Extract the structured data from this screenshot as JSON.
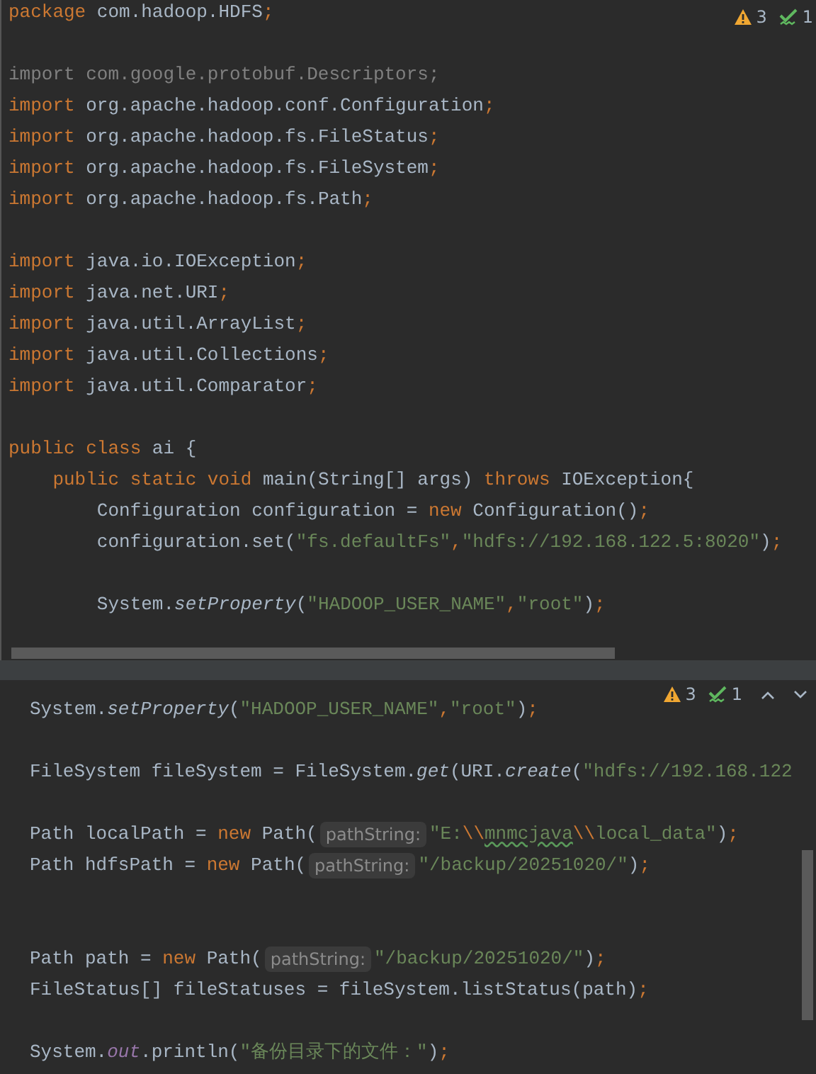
{
  "top_pane": {
    "inspections": {
      "warnings": "3",
      "weak_warnings": "1"
    },
    "lines": [
      {
        "kind": "code",
        "tokens": [
          {
            "kind": "kw",
            "text": "package"
          },
          {
            "kind": "plain",
            "text": " com.hadoop.HDFS"
          },
          {
            "kind": "punct",
            "text": ";"
          }
        ]
      },
      {
        "kind": "blank"
      },
      {
        "kind": "code",
        "tokens": [
          {
            "kind": "unused",
            "text": "import com.google.protobuf.Descriptors;"
          }
        ]
      },
      {
        "kind": "code",
        "tokens": [
          {
            "kind": "kw",
            "text": "import"
          },
          {
            "kind": "plain",
            "text": " org.apache.hadoop.conf.Configuration"
          },
          {
            "kind": "punct",
            "text": ";"
          }
        ]
      },
      {
        "kind": "code",
        "tokens": [
          {
            "kind": "kw",
            "text": "import"
          },
          {
            "kind": "plain",
            "text": " org.apache.hadoop.fs.FileStatus"
          },
          {
            "kind": "punct",
            "text": ";"
          }
        ]
      },
      {
        "kind": "code",
        "tokens": [
          {
            "kind": "kw",
            "text": "import"
          },
          {
            "kind": "plain",
            "text": " org.apache.hadoop.fs.FileSystem"
          },
          {
            "kind": "punct",
            "text": ";"
          }
        ]
      },
      {
        "kind": "code",
        "tokens": [
          {
            "kind": "kw",
            "text": "import"
          },
          {
            "kind": "plain",
            "text": " org.apache.hadoop.fs.Path"
          },
          {
            "kind": "punct",
            "text": ";"
          }
        ]
      },
      {
        "kind": "blank"
      },
      {
        "kind": "code",
        "tokens": [
          {
            "kind": "kw",
            "text": "import"
          },
          {
            "kind": "plain",
            "text": " java.io.IOException"
          },
          {
            "kind": "punct",
            "text": ";"
          }
        ]
      },
      {
        "kind": "code",
        "tokens": [
          {
            "kind": "kw",
            "text": "import"
          },
          {
            "kind": "plain",
            "text": " java.net.URI"
          },
          {
            "kind": "punct",
            "text": ";"
          }
        ]
      },
      {
        "kind": "code",
        "tokens": [
          {
            "kind": "kw",
            "text": "import"
          },
          {
            "kind": "plain",
            "text": " java.util.ArrayList"
          },
          {
            "kind": "punct",
            "text": ";"
          }
        ]
      },
      {
        "kind": "code",
        "tokens": [
          {
            "kind": "kw",
            "text": "import"
          },
          {
            "kind": "plain",
            "text": " java.util.Collections"
          },
          {
            "kind": "punct",
            "text": ";"
          }
        ]
      },
      {
        "kind": "code",
        "tokens": [
          {
            "kind": "kw",
            "text": "import"
          },
          {
            "kind": "plain",
            "text": " java.util.Comparator"
          },
          {
            "kind": "punct",
            "text": ";"
          }
        ]
      },
      {
        "kind": "blank"
      },
      {
        "kind": "code",
        "tokens": [
          {
            "kind": "kw",
            "text": "public class"
          },
          {
            "kind": "plain",
            "text": " ai {"
          }
        ]
      },
      {
        "kind": "code",
        "tokens": [
          {
            "kind": "kw",
            "text": "    public static void"
          },
          {
            "kind": "plain",
            "text": " main(String[] args) "
          },
          {
            "kind": "kw",
            "text": "throws"
          },
          {
            "kind": "plain",
            "text": " IOException{"
          }
        ]
      },
      {
        "kind": "code",
        "tokens": [
          {
            "kind": "plain",
            "text": "        Configuration configuration = "
          },
          {
            "kind": "kw",
            "text": "new"
          },
          {
            "kind": "plain",
            "text": " Configuration()"
          },
          {
            "kind": "punct",
            "text": ";"
          }
        ]
      },
      {
        "kind": "code",
        "tokens": [
          {
            "kind": "plain",
            "text": "        configuration.set("
          },
          {
            "kind": "str",
            "text": "\"fs.defaultFs\""
          },
          {
            "kind": "punct",
            "text": ","
          },
          {
            "kind": "str",
            "text": "\"hdfs://192.168.122.5:8020\""
          },
          {
            "kind": "plain",
            "text": ")"
          },
          {
            "kind": "punct",
            "text": ";"
          }
        ]
      },
      {
        "kind": "blank"
      },
      {
        "kind": "code",
        "tokens": [
          {
            "kind": "plain",
            "text": "        System."
          },
          {
            "kind": "method",
            "text": "setProperty"
          },
          {
            "kind": "plain",
            "text": "("
          },
          {
            "kind": "str",
            "text": "\"HADOOP_USER_NAME\""
          },
          {
            "kind": "punct",
            "text": ","
          },
          {
            "kind": "str",
            "text": "\"root\""
          },
          {
            "kind": "plain",
            "text": ")"
          },
          {
            "kind": "punct",
            "text": ";"
          }
        ]
      }
    ]
  },
  "bottom_pane": {
    "inspections": {
      "warnings": "3",
      "weak_warnings": "1"
    },
    "lines": [
      {
        "kind": "code",
        "tokens": [
          {
            "kind": "plain",
            "text": "System."
          },
          {
            "kind": "method",
            "text": "setProperty"
          },
          {
            "kind": "plain",
            "text": "("
          },
          {
            "kind": "str",
            "text": "\"HADOOP_USER_NAME\""
          },
          {
            "kind": "punct",
            "text": ","
          },
          {
            "kind": "str",
            "text": "\"root\""
          },
          {
            "kind": "plain",
            "text": ")"
          },
          {
            "kind": "punct",
            "text": ";"
          }
        ]
      },
      {
        "kind": "blank"
      },
      {
        "kind": "code",
        "tokens": [
          {
            "kind": "plain",
            "text": "FileSystem fileSystem = FileSystem."
          },
          {
            "kind": "method",
            "text": "get"
          },
          {
            "kind": "plain",
            "text": "(URI."
          },
          {
            "kind": "method",
            "text": "create"
          },
          {
            "kind": "plain",
            "text": "("
          },
          {
            "kind": "str",
            "text": "\"hdfs://192.168.122"
          }
        ]
      },
      {
        "kind": "blank"
      },
      {
        "kind": "code",
        "tokens": [
          {
            "kind": "plain",
            "text": "Path localPath = "
          },
          {
            "kind": "kw",
            "text": "new"
          },
          {
            "kind": "plain",
            "text": " Path("
          },
          {
            "kind": "hint",
            "text": "pathString:"
          },
          {
            "kind": "str",
            "text": "\"E:"
          },
          {
            "kind": "kw",
            "text": "\\\\"
          },
          {
            "kind": "typo",
            "text": "mnmcjava"
          },
          {
            "kind": "kw",
            "text": "\\\\"
          },
          {
            "kind": "str",
            "text": "local_data\""
          },
          {
            "kind": "plain",
            "text": ")"
          },
          {
            "kind": "punct",
            "text": ";"
          }
        ]
      },
      {
        "kind": "code",
        "tokens": [
          {
            "kind": "plain",
            "text": "Path hdfsPath = "
          },
          {
            "kind": "kw",
            "text": "new"
          },
          {
            "kind": "plain",
            "text": " Path("
          },
          {
            "kind": "hint",
            "text": "pathString:"
          },
          {
            "kind": "str",
            "text": "\"/backup/20251020/\""
          },
          {
            "kind": "plain",
            "text": ")"
          },
          {
            "kind": "punct",
            "text": ";"
          }
        ]
      },
      {
        "kind": "blank"
      },
      {
        "kind": "blank"
      },
      {
        "kind": "code",
        "tokens": [
          {
            "kind": "plain",
            "text": "Path path = "
          },
          {
            "kind": "kw",
            "text": "new"
          },
          {
            "kind": "plain",
            "text": " Path("
          },
          {
            "kind": "hint",
            "text": "pathString:"
          },
          {
            "kind": "str",
            "text": "\"/backup/20251020/\""
          },
          {
            "kind": "plain",
            "text": ")"
          },
          {
            "kind": "punct",
            "text": ";"
          }
        ]
      },
      {
        "kind": "code",
        "tokens": [
          {
            "kind": "plain",
            "text": "FileStatus[] fileStatuses = fileSystem.listStatus(path)"
          },
          {
            "kind": "punct",
            "text": ";"
          }
        ]
      },
      {
        "kind": "blank"
      },
      {
        "kind": "code",
        "tokens": [
          {
            "kind": "plain",
            "text": "System."
          },
          {
            "kind": "field",
            "text": "out"
          },
          {
            "kind": "plain",
            "text": ".println("
          },
          {
            "kind": "str",
            "text": "\"备份目录下的文件：\""
          },
          {
            "kind": "plain",
            "text": ")"
          },
          {
            "kind": "punct",
            "text": ";"
          }
        ]
      }
    ]
  }
}
